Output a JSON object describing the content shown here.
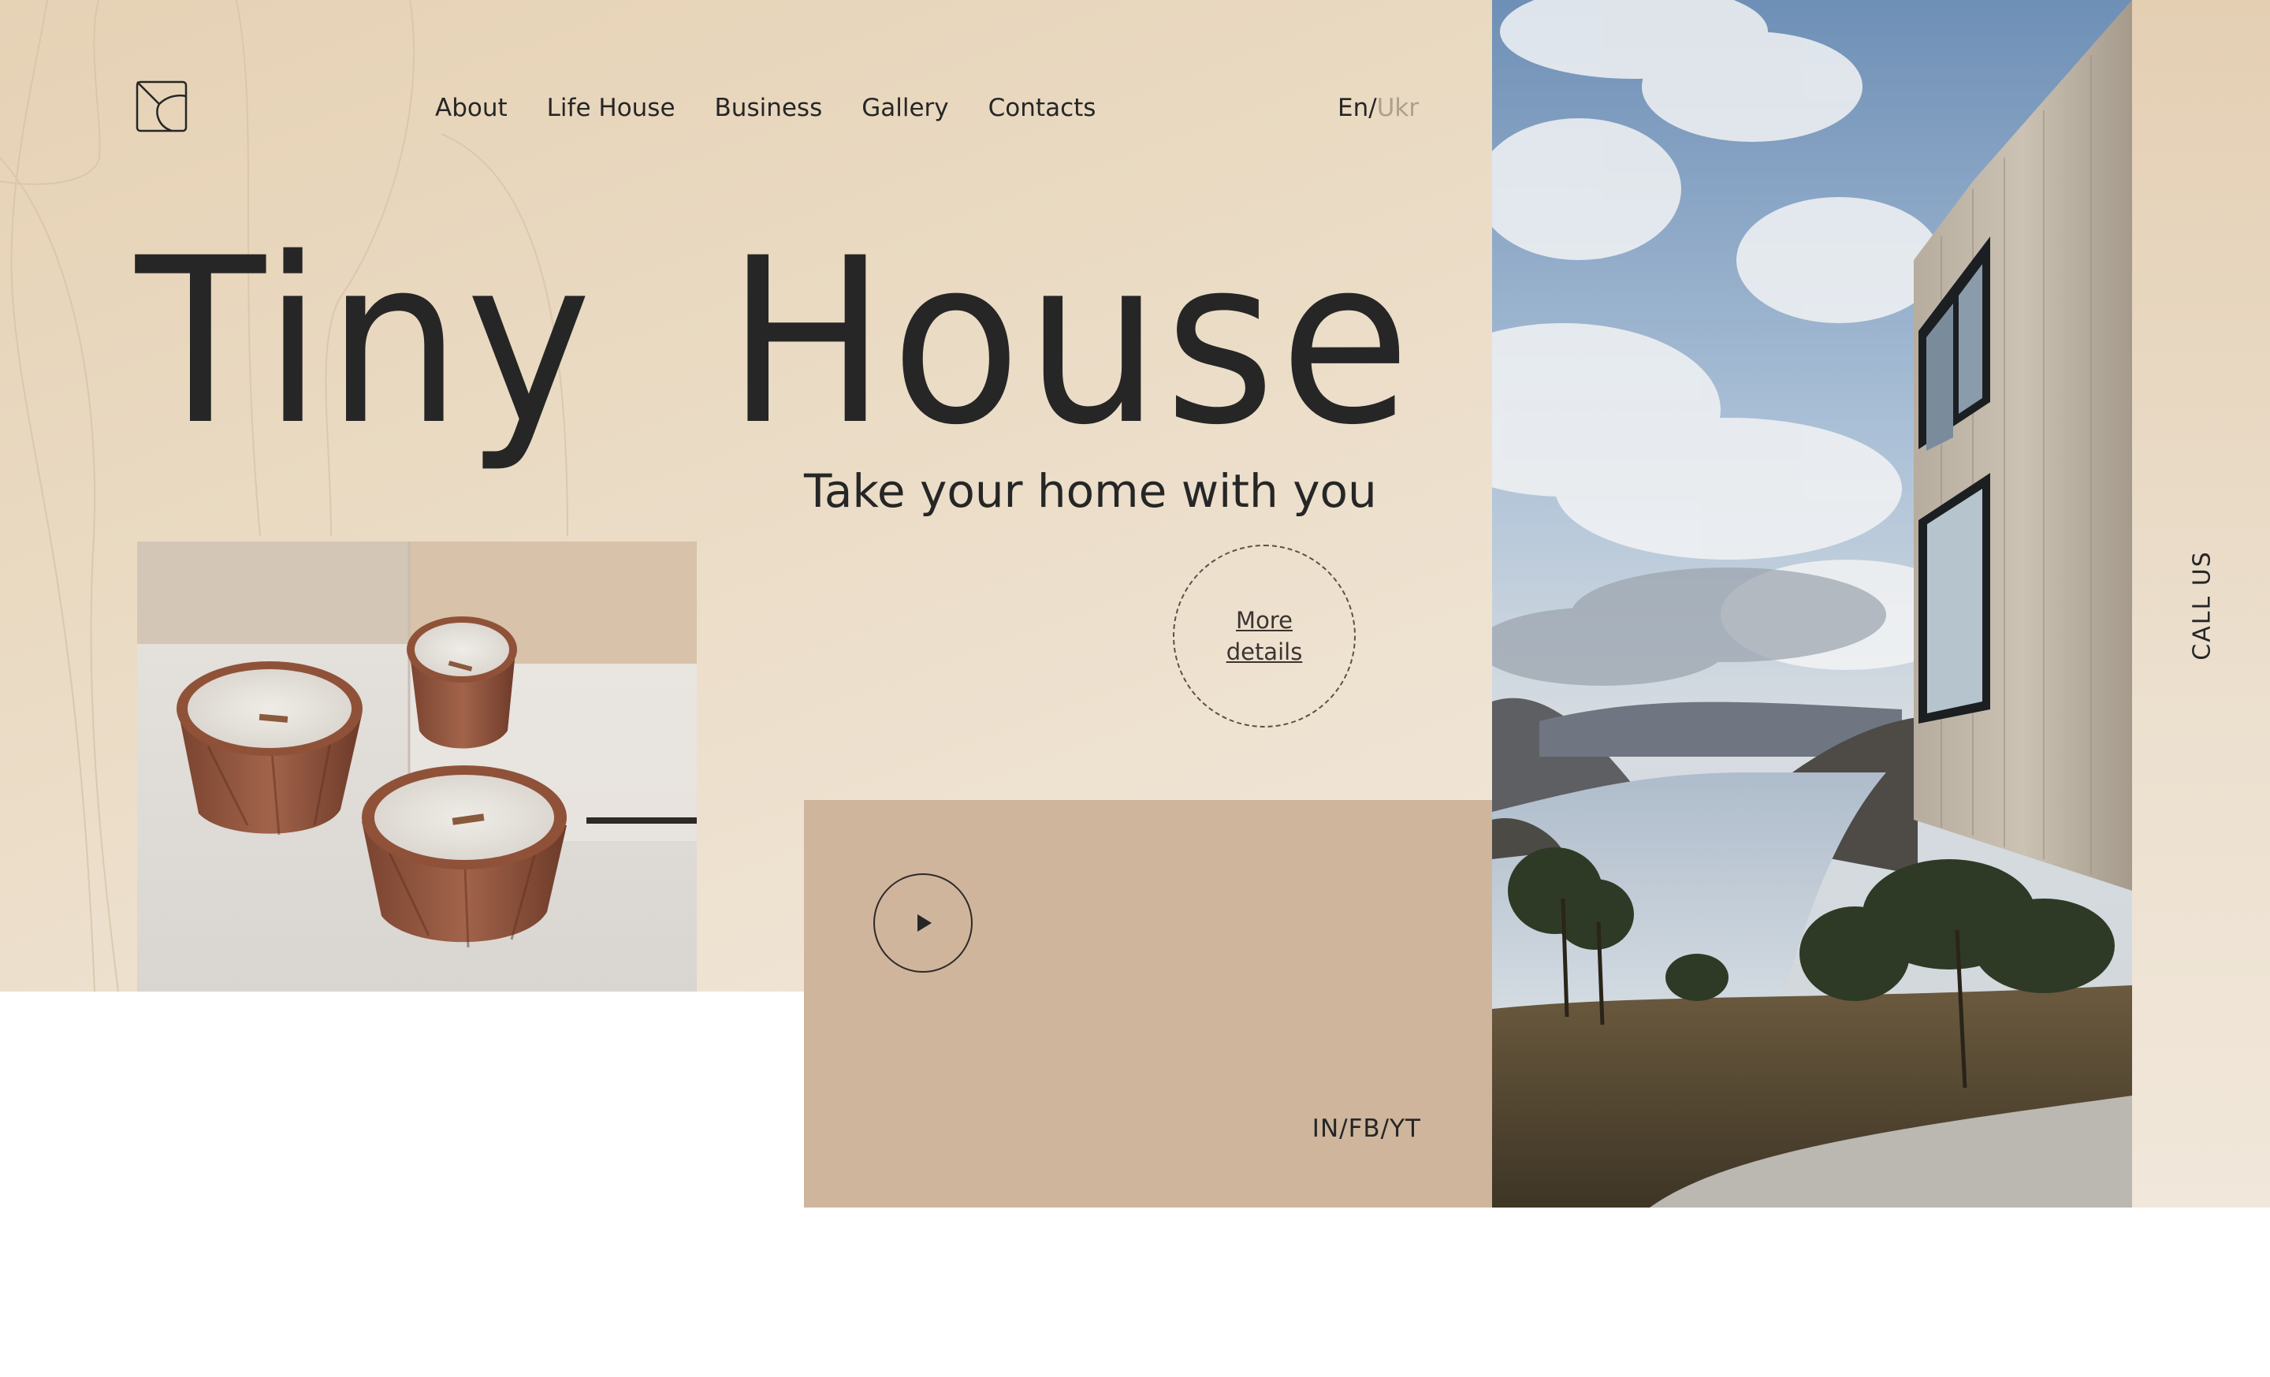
{
  "nav": {
    "items": [
      "About",
      "Life House",
      "Business",
      "Gallery",
      "Contacts"
    ]
  },
  "language": {
    "active": "En",
    "separator": "/",
    "inactive": "Ukr"
  },
  "hero": {
    "title": "Tiny  House",
    "subtitle": "Take your home with you",
    "more_details_line1": "More",
    "more_details_line2": "details"
  },
  "video": {
    "social_links": "IN/FB/YT",
    "play_icon": "play-icon"
  },
  "sidebar": {
    "call_us": "CALL US"
  },
  "icons": {
    "logo": "logo-icon",
    "play": "play-icon"
  },
  "colors": {
    "hero_background": "#e8d6bd",
    "video_panel": "#ceb59c",
    "text": "#262626",
    "inactive_language": "#ad9f8f"
  }
}
